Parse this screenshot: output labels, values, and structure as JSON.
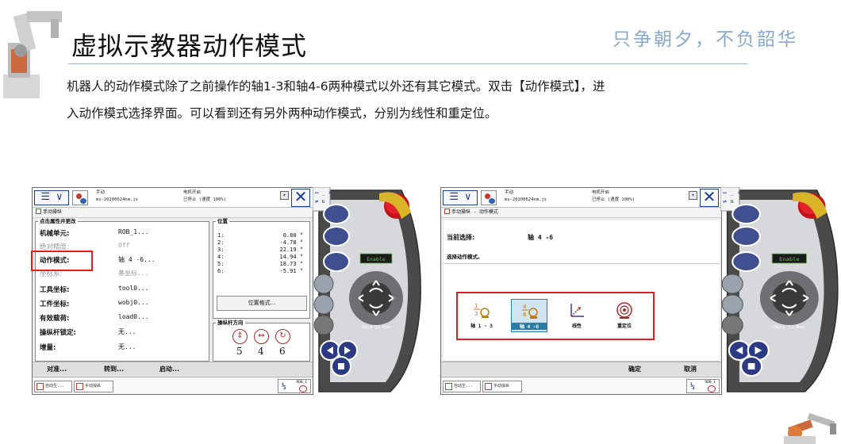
{
  "slide": {
    "title": "虚拟示教器动作模式",
    "slogan": "只争朝夕，不负韶华",
    "body_line1": "机器人的动作模式除了之前操作的轴1-3和轴4-6两种模式以外还有其它模式。双击【动作模式】，进",
    "body_line2": "入动作模式选择界面。可以看到还有另外两种动作模式，分别为线性和重定位。"
  },
  "left_pendant": {
    "header": {
      "mode_label": "手动",
      "file_name": "ms-20200624nm.js",
      "motor_state": "电机开启",
      "status": "已停止 (速度 100%)"
    },
    "breadcrumb": "手动操纵",
    "props_legend": "点击属性并更改",
    "props": [
      {
        "key": "机械单元:",
        "value": "ROB_1..."
      },
      {
        "key": "绝对精度:",
        "value": "Off"
      },
      {
        "key": "动作模式:",
        "value": "轴 4 -6..."
      },
      {
        "key": "坐标系:",
        "value": "基坐标..."
      },
      {
        "key": "工具坐标:",
        "value": "tool0..."
      },
      {
        "key": "工件坐标:",
        "value": "wobj0..."
      },
      {
        "key": "有效载荷:",
        "value": "load0..."
      },
      {
        "key": "操纵杆锁定:",
        "value": "无..."
      },
      {
        "key": "增量:",
        "value": "无..."
      }
    ],
    "position_legend": "位置",
    "positions": [
      {
        "axis": "1:",
        "value": "0.80 °"
      },
      {
        "axis": "2:",
        "value": "-4.78 °"
      },
      {
        "axis": "3:",
        "value": "22.19 °"
      },
      {
        "axis": "4:",
        "value": "14.94 °"
      },
      {
        "axis": "5:",
        "value": "18.73 °"
      },
      {
        "axis": "6:",
        "value": "-5.91 °"
      }
    ],
    "position_format_button": "位置格式...",
    "joystick_legend": "操纵杆方向",
    "joystick_numbers": [
      "5",
      "4",
      "6"
    ],
    "commands": [
      "对准...",
      "转到...",
      "启动..."
    ],
    "taskbar": [
      "自动生...",
      "手动操纵"
    ],
    "rob_label": "ROB_1",
    "rob_fraction": "⅓"
  },
  "right_pendant": {
    "header": {
      "mode_label": "手动",
      "file_name": "ms-20200624nm.js",
      "motor_state": "电机开启",
      "status": "已停止 (速度 100%)"
    },
    "breadcrumb": "手动操纵 - 动作模式",
    "current_label": "当前选择:",
    "current_value": "轴 4 -6",
    "choose_label": "选择动作模式。",
    "modes": [
      {
        "label": "轴 1 - 3",
        "icon": "axis-1-3-icon",
        "selected": false
      },
      {
        "label": "轴 4 -6",
        "icon": "axis-4-6-icon",
        "selected": true
      },
      {
        "label": "线性",
        "icon": "linear-icon",
        "selected": false
      },
      {
        "label": "重定位",
        "icon": "reorient-icon",
        "selected": false
      }
    ],
    "ok_button": "确定",
    "cancel_button": "取消",
    "taskbar": [
      "自动生...",
      "手动操纵"
    ],
    "rob_label": "ROB_1",
    "rob_fraction": "⅓"
  },
  "hardware": {
    "enable_label": "Enable",
    "hold_label": "Hold To Run"
  },
  "colors": {
    "highlight_red": "#e0201a",
    "pendant_blue": "#1d3d8f",
    "slogan": "#8aa9c8",
    "selected_mode": "#2a7da7"
  }
}
